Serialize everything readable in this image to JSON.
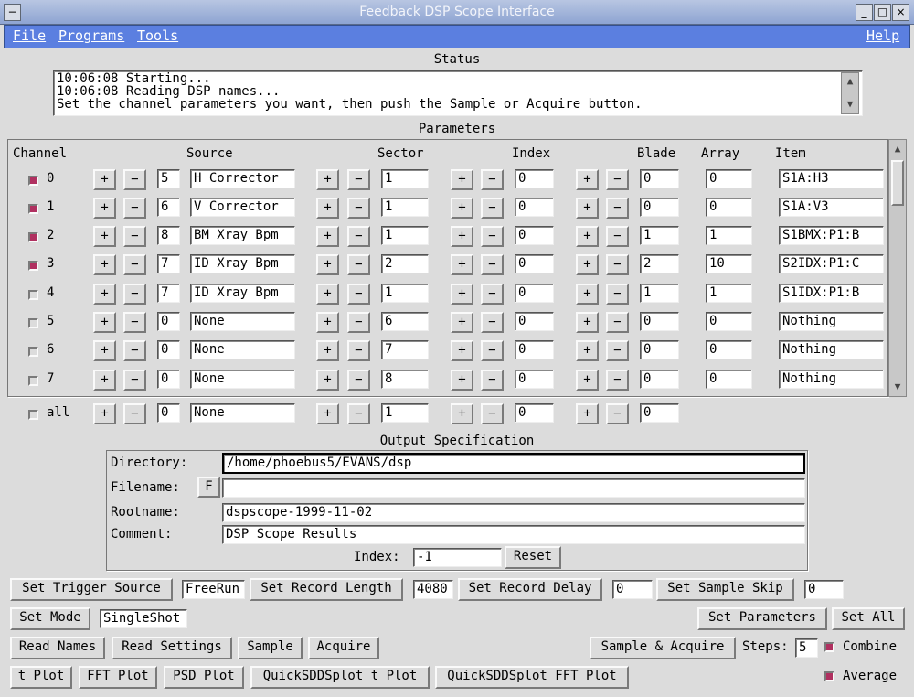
{
  "window": {
    "title": "Feedback DSP Scope Interface"
  },
  "menu": {
    "file": "File",
    "programs": "Programs",
    "tools": "Tools",
    "help": "Help"
  },
  "status": {
    "heading": "Status",
    "lines": [
      "10:06:08 Starting...",
      "10:06:08 Reading DSP names...",
      "Set the channel parameters you want, then push the Sample or Acquire button."
    ]
  },
  "parameters": {
    "heading": "Parameters",
    "headers": {
      "channel": "Channel",
      "source": "Source",
      "sector": "Sector",
      "index": "Index",
      "blade": "Blade",
      "array": "Array",
      "item": "Item"
    },
    "plus": "+",
    "minus": "−",
    "rows": [
      {
        "ch": "0",
        "on": true,
        "src_num": "5",
        "src_name": "H Corrector",
        "sector": "1",
        "index": "0",
        "blade": "0",
        "array": "0",
        "item": "S1A:H3"
      },
      {
        "ch": "1",
        "on": true,
        "src_num": "6",
        "src_name": "V Corrector",
        "sector": "1",
        "index": "0",
        "blade": "0",
        "array": "0",
        "item": "S1A:V3"
      },
      {
        "ch": "2",
        "on": true,
        "src_num": "8",
        "src_name": "BM Xray Bpm",
        "sector": "1",
        "index": "0",
        "blade": "1",
        "array": "1",
        "item": "S1BMX:P1:B"
      },
      {
        "ch": "3",
        "on": true,
        "src_num": "7",
        "src_name": "ID Xray Bpm",
        "sector": "2",
        "index": "0",
        "blade": "2",
        "array": "10",
        "item": "S2IDX:P1:C"
      },
      {
        "ch": "4",
        "on": false,
        "src_num": "7",
        "src_name": "ID Xray Bpm",
        "sector": "1",
        "index": "0",
        "blade": "1",
        "array": "1",
        "item": "S1IDX:P1:B"
      },
      {
        "ch": "5",
        "on": false,
        "src_num": "0",
        "src_name": "None",
        "sector": "6",
        "index": "0",
        "blade": "0",
        "array": "0",
        "item": "Nothing"
      },
      {
        "ch": "6",
        "on": false,
        "src_num": "0",
        "src_name": "None",
        "sector": "7",
        "index": "0",
        "blade": "0",
        "array": "0",
        "item": "Nothing"
      },
      {
        "ch": "7",
        "on": false,
        "src_num": "0",
        "src_name": "None",
        "sector": "8",
        "index": "0",
        "blade": "0",
        "array": "0",
        "item": "Nothing"
      }
    ],
    "all": {
      "label": "all",
      "on": false,
      "src_num": "0",
      "src_name": "None",
      "sector": "1",
      "index": "0",
      "blade": "0"
    }
  },
  "output": {
    "heading": "Output Specification",
    "directory_label": "Directory:",
    "directory": "/home/phoebus5/EVANS/dsp",
    "filename_label": "Filename:",
    "filename_btn": "F",
    "filename": "",
    "rootname_label": "Rootname:",
    "rootname": "dspscope-1999-11-02",
    "comment_label": "Comment:",
    "comment": "DSP Scope Results",
    "index_label": "Index:",
    "index": "-1",
    "reset": "Reset"
  },
  "controls": {
    "set_trigger_source": "Set Trigger Source",
    "trigger_value": "FreeRun",
    "set_record_length": "Set Record Length",
    "record_length": "4080",
    "set_record_delay": "Set Record Delay",
    "record_delay": "0",
    "set_sample_skip": "Set Sample Skip",
    "sample_skip": "0",
    "set_mode": "Set Mode",
    "mode_value": "SingleShot",
    "set_parameters": "Set Parameters",
    "set_all": "Set All",
    "read_names": "Read Names",
    "read_settings": "Read Settings",
    "sample": "Sample",
    "acquire": "Acquire",
    "sample_acquire": "Sample & Acquire",
    "steps_label": "Steps:",
    "steps": "5",
    "combine": "Combine",
    "combine_on": true,
    "t_plot": "t Plot",
    "fft_plot": "FFT Plot",
    "psd_plot": "PSD Plot",
    "quick_t_plot": "QuickSDDSplot t Plot",
    "quick_fft_plot": "QuickSDDSplot FFT Plot",
    "average": "Average",
    "average_on": true
  },
  "colors": {
    "menubar": "#5b7fe0",
    "checked": "#b03060",
    "background": "#dcdcdc"
  }
}
